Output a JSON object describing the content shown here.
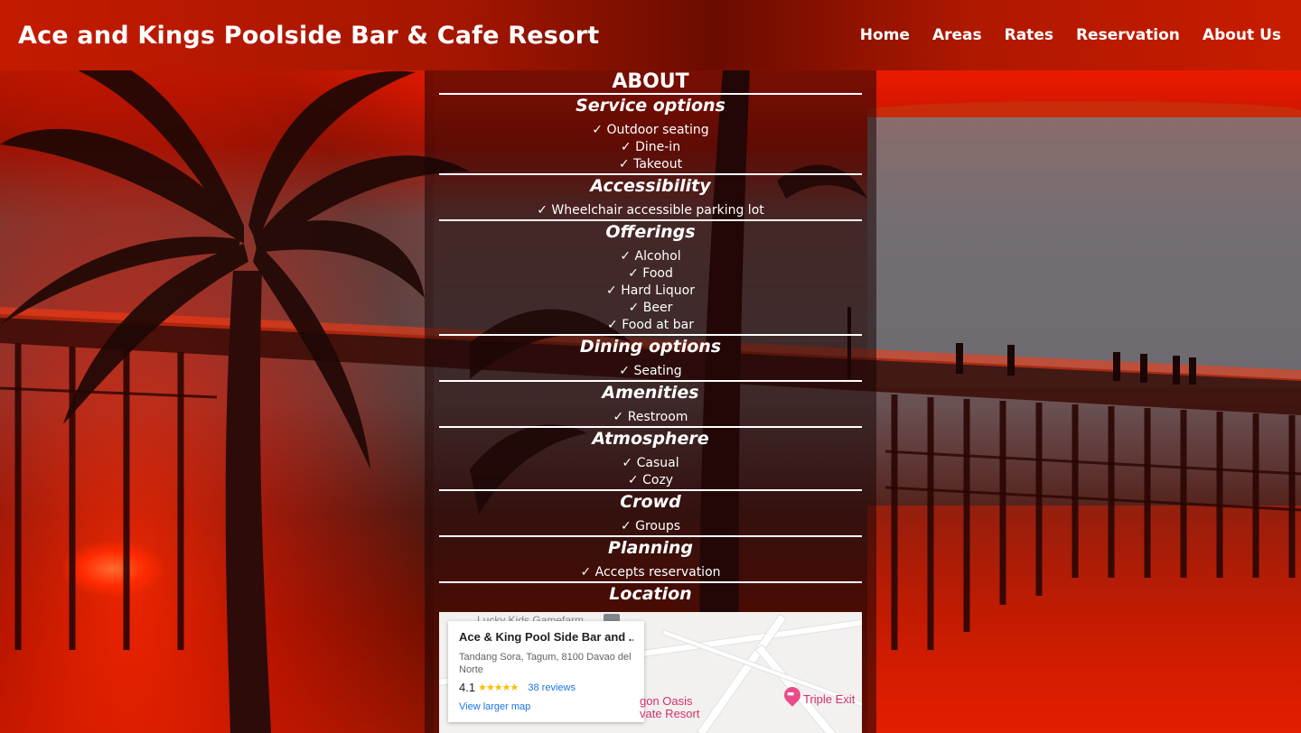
{
  "header": {
    "brand": "Ace and Kings Poolside Bar & Cafe Resort",
    "nav": [
      "Home",
      "Areas",
      "Rates",
      "Reservation",
      "About Us"
    ]
  },
  "about": {
    "title": "ABOUT",
    "sections": [
      {
        "title": "Service options",
        "items": [
          "✓ Outdoor seating",
          "✓ Dine-in",
          "✓ Takeout"
        ]
      },
      {
        "title": "Accessibility",
        "items": [
          "✓ Wheelchair accessible parking lot"
        ]
      },
      {
        "title": "Offerings",
        "items": [
          "✓ Alcohol",
          "✓ Food",
          "✓ Hard Liquor",
          "✓ Beer",
          "✓ Food at bar"
        ]
      },
      {
        "title": "Dining options",
        "items": [
          "✓ Seating"
        ]
      },
      {
        "title": "Amenities",
        "items": [
          "✓ Restroom"
        ]
      },
      {
        "title": "Atmosphere",
        "items": [
          "✓ Casual",
          "✓ Cozy"
        ]
      },
      {
        "title": "Crowd",
        "items": [
          "✓ Groups"
        ]
      },
      {
        "title": "Planning",
        "items": [
          "✓ Accepts reservation"
        ]
      }
    ],
    "location_title": "Location"
  },
  "map": {
    "top_label": "Lucky Kids Gamefarm",
    "card": {
      "name": "Ace & King Pool Side Bar and ...",
      "address": "Tandang Sora, Tagum, 8100 Davao del Norte",
      "rating": "4.1",
      "stars": "★★★★★",
      "reviews": "38 reviews",
      "larger_map": "View larger map"
    },
    "poi_1": "gon Oasis",
    "poi_1b": "vate Resort",
    "poi_2": "Triple Exit"
  },
  "colors": {
    "header_red": "#c41b00",
    "map_link": "#1a73e8",
    "poi_pink": "#d5306a"
  }
}
